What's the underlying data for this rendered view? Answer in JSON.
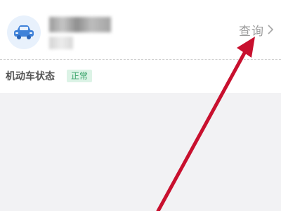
{
  "vehicle_card": {
    "icon": "car-icon",
    "query_label": "查询",
    "status_label": "机动车状态",
    "status_value": "正常"
  },
  "annotation": {
    "arrow_color": "#c8102e"
  },
  "colors": {
    "accent_blue": "#3f82d9",
    "badge_green_bg": "#dcf3e6",
    "badge_green_text": "#3aa36a"
  }
}
